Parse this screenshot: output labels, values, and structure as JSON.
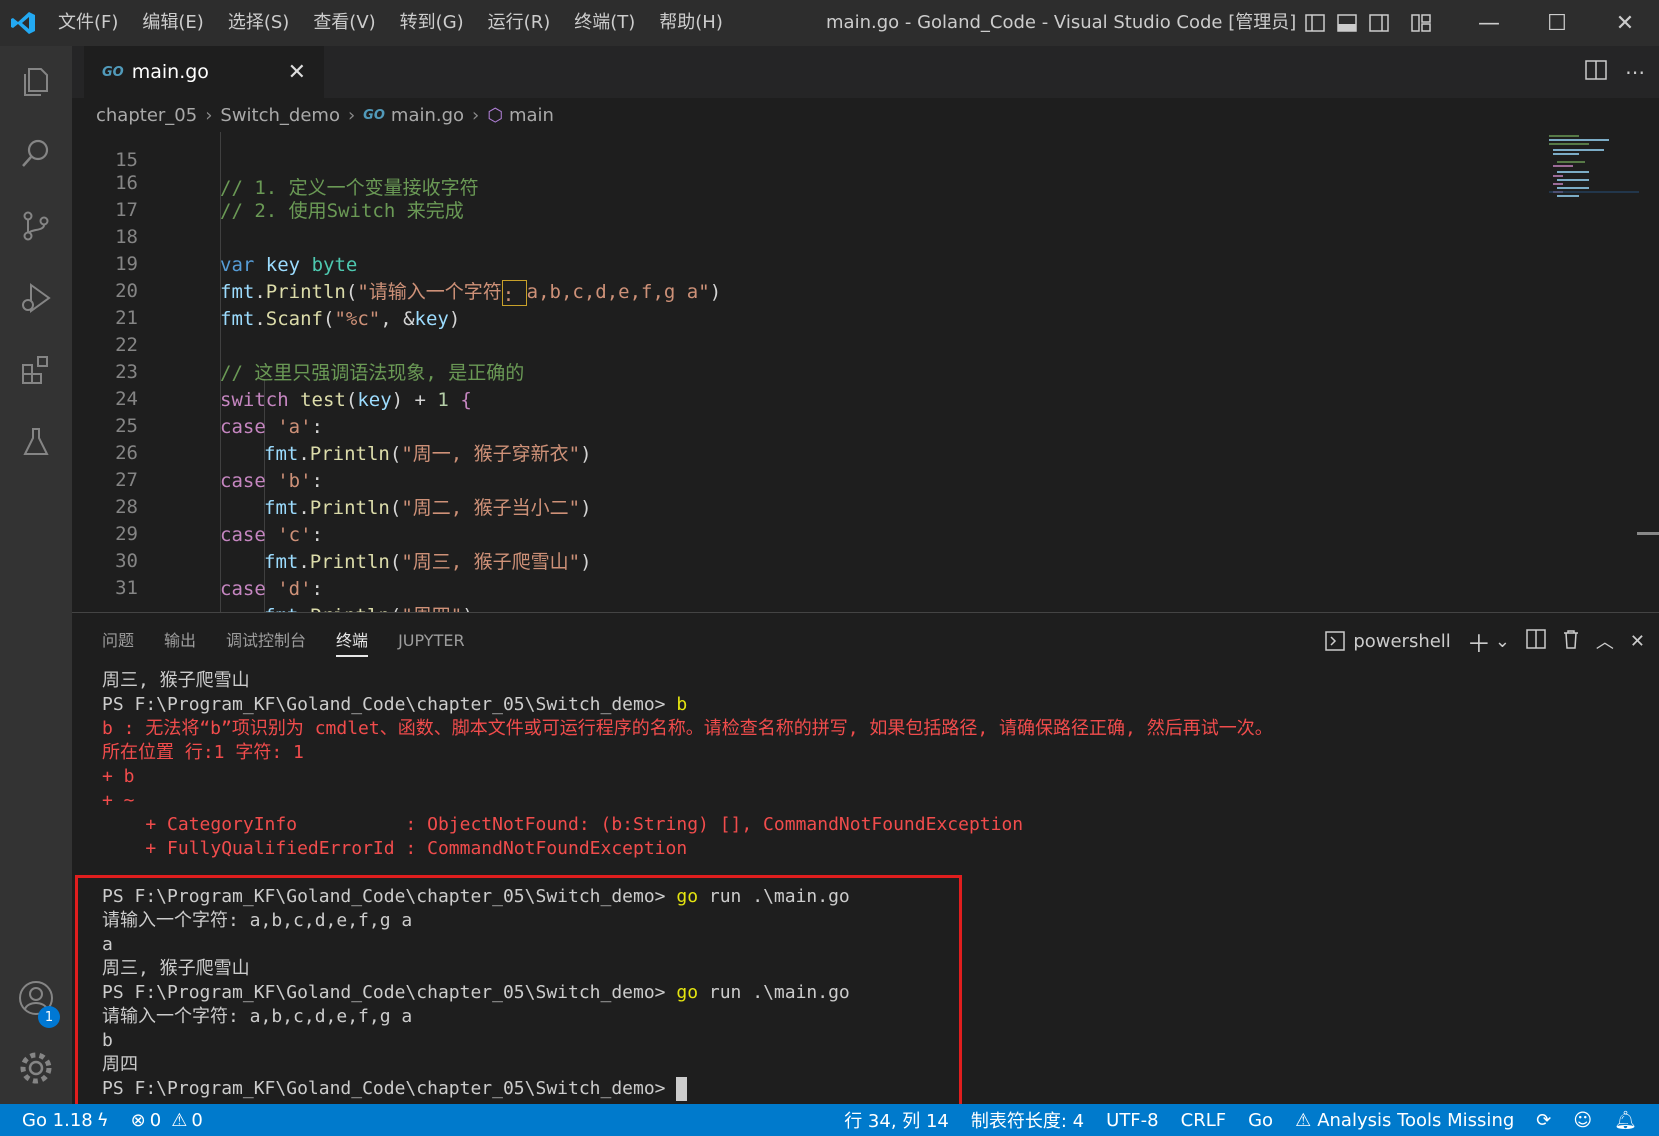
{
  "app": {
    "menu": [
      "文件(F)",
      "编辑(E)",
      "选择(S)",
      "查看(V)",
      "转到(G)",
      "运行(R)",
      "终端(T)",
      "帮助(H)"
    ],
    "window_title": "main.go - Goland_Code - Visual Studio Code [管理员]",
    "window_controls": {
      "minimize": "—",
      "maximize": "☐",
      "close": "✕"
    }
  },
  "tab": {
    "icon_label": "GO",
    "label": "main.go"
  },
  "breadcrumb": [
    "chapter_05",
    "Switch_demo",
    "main.go",
    "main"
  ],
  "editor": {
    "lines": [
      {
        "n": "15",
        "text": "// 1. 定义一个变量接收字符"
      },
      {
        "n": "16",
        "text": "// 2. 使用Switch 来完成"
      },
      {
        "n": "17",
        "text": ""
      },
      {
        "n": "18",
        "text": "var key byte"
      },
      {
        "n": "19",
        "text": "fmt.Println(\"请输入一个字符: a,b,c,d,e,f,g a\")"
      },
      {
        "n": "20",
        "text": "fmt.Scanf(\"%c\", &key)"
      },
      {
        "n": "21",
        "text": ""
      },
      {
        "n": "22",
        "text": "// 这里只强调语法现象, 是正确的"
      },
      {
        "n": "23",
        "text": "switch test(key) + 1 {"
      },
      {
        "n": "24",
        "text": "case 'a':"
      },
      {
        "n": "25",
        "text": "fmt.Println(\"周一, 猴子穿新衣\")"
      },
      {
        "n": "26",
        "text": "case 'b':"
      },
      {
        "n": "27",
        "text": "fmt.Println(\"周二, 猴子当小二\")"
      },
      {
        "n": "28",
        "text": "case 'c':"
      },
      {
        "n": "29",
        "text": "fmt.Println(\"周三, 猴子爬雪山\")"
      },
      {
        "n": "30",
        "text": "case 'd':"
      },
      {
        "n": "31",
        "text": "fmt.Println(\"周四\")"
      }
    ]
  },
  "panel": {
    "tabs": [
      "问题",
      "输出",
      "调试控制台",
      "终端",
      "JUPYTER"
    ],
    "active_tab": "终端",
    "shell": "powershell"
  },
  "terminal": {
    "lines": [
      {
        "text": "周三, 猴子爬雪山",
        "style": "normal"
      },
      {
        "text": "PS F:\\Program_KF\\Goland_Code\\chapter_05\\Switch_demo> ",
        "cmd": "b",
        "style": "prompt"
      },
      {
        "text": "b : 无法将“b”项识别为 cmdlet、函数、脚本文件或可运行程序的名称。请检查名称的拼写, 如果包括路径, 请确保路径正确, 然后再试一次。",
        "style": "err"
      },
      {
        "text": "所在位置 行:1 字符: 1",
        "style": "err"
      },
      {
        "text": "+ b",
        "style": "err"
      },
      {
        "text": "+ ~",
        "style": "err"
      },
      {
        "text": "    + CategoryInfo          : ObjectNotFound: (b:String) [], CommandNotFoundException",
        "style": "err"
      },
      {
        "text": "    + FullyQualifiedErrorId : CommandNotFoundException",
        "style": "err"
      },
      {
        "text": "",
        "style": "normal"
      },
      {
        "text": "PS F:\\Program_KF\\Goland_Code\\chapter_05\\Switch_demo> ",
        "cmd": "go",
        "args": " run .\\main.go",
        "style": "prompt"
      },
      {
        "text": "请输入一个字符: a,b,c,d,e,f,g a",
        "style": "normal"
      },
      {
        "text": "a",
        "style": "normal"
      },
      {
        "text": "周三, 猴子爬雪山",
        "style": "normal"
      },
      {
        "text": "PS F:\\Program_KF\\Goland_Code\\chapter_05\\Switch_demo> ",
        "cmd": "go",
        "args": " run .\\main.go",
        "style": "prompt"
      },
      {
        "text": "请输入一个字符: a,b,c,d,e,f,g a",
        "style": "normal"
      },
      {
        "text": "b",
        "style": "normal"
      },
      {
        "text": "周四",
        "style": "normal"
      },
      {
        "text": "PS F:\\Program_KF\\Goland_Code\\chapter_05\\Switch_demo> ",
        "style": "cursor"
      }
    ]
  },
  "statusbar": {
    "go_version": "Go 1.18",
    "errors": "0",
    "warnings": "0",
    "position": "行 34, 列 14",
    "tab_size": "制表符长度: 4",
    "encoding": "UTF-8",
    "eol": "CRLF",
    "language": "Go",
    "analysis": "Analysis Tools Missing",
    "notifications_badge": "1"
  },
  "colors": {
    "accent": "#007acc",
    "highlight_box": "#e01e1e"
  }
}
